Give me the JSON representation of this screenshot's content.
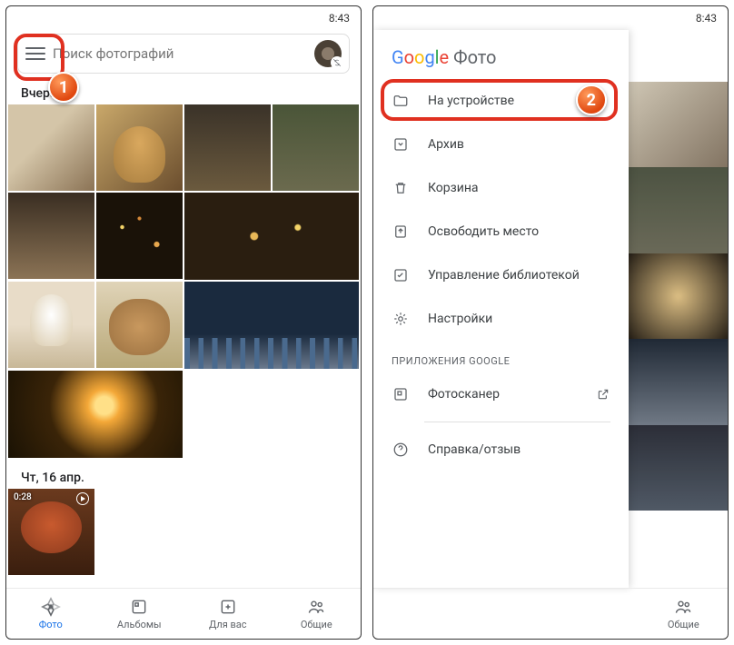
{
  "status_time": "8:43",
  "search": {
    "placeholder": "Поиск фотографий"
  },
  "sections": [
    {
      "title": "Вчера"
    },
    {
      "title": "Чт, 16 апр."
    }
  ],
  "video_duration": "0:28",
  "nav": [
    {
      "label": "Фото"
    },
    {
      "label": "Альбомы"
    },
    {
      "label": "Для вас"
    },
    {
      "label": "Общие"
    }
  ],
  "drawer": {
    "brand_text": "Фото",
    "items": [
      {
        "label": "На устройстве"
      },
      {
        "label": "Архив"
      },
      {
        "label": "Корзина"
      },
      {
        "label": "Освободить место"
      },
      {
        "label": "Управление библиотекой"
      },
      {
        "label": "Настройки"
      }
    ],
    "section_label": "ПРИЛОЖЕНИЯ GOOGLE",
    "apps": [
      {
        "label": "Фотосканер"
      }
    ],
    "help": {
      "label": "Справка/отзыв"
    }
  },
  "callouts": {
    "one": "1",
    "two": "2"
  }
}
